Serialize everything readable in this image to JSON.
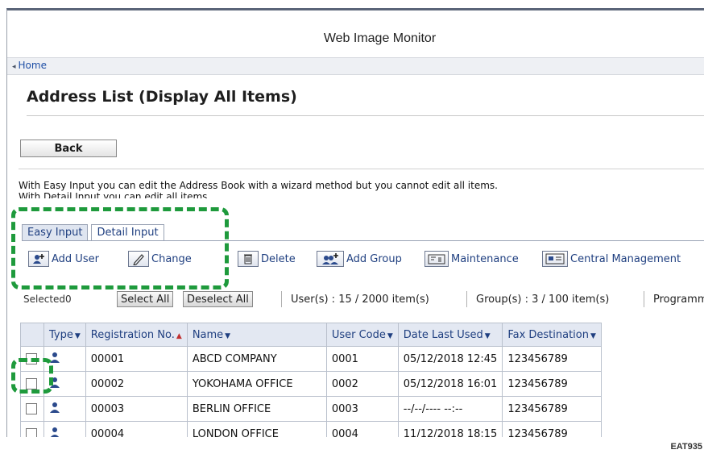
{
  "window": {
    "title": "Web Image Monitor"
  },
  "nav": {
    "home": "Home"
  },
  "page": {
    "title": "Address List (Display All Items)"
  },
  "buttons": {
    "back": "Back"
  },
  "description": {
    "line1": "With Easy Input you can edit the Address Book with a wizard method but you cannot edit all items.",
    "line2": "With Detail Input you can edit all items."
  },
  "tabs": [
    {
      "label": "Easy Input",
      "active": false
    },
    {
      "label": "Detail Input",
      "active": true
    }
  ],
  "toolbar": {
    "add_user": "Add User",
    "change": "Change",
    "delete": "Delete",
    "add_group": "Add Group",
    "maintenance": "Maintenance",
    "central_management": "Central Management"
  },
  "selection": {
    "label": "Selected0",
    "select_all": "Select All",
    "deselect_all": "Deselect All",
    "users": "User(s) : 15 / 2000 item(s)",
    "groups": "Group(s) : 3 / 100 item(s)",
    "program": "Programm"
  },
  "table": {
    "headers": {
      "type": "Type",
      "reg_no": "Registration No.",
      "name": "Name",
      "user_code": "User Code",
      "date_last_used": "Date Last Used",
      "fax_destination": "Fax Destination"
    },
    "rows": [
      {
        "reg_no": "00001",
        "name": "ABCD COMPANY",
        "user_code": "0001",
        "date": "05/12/2018 12:45",
        "fax": "123456789"
      },
      {
        "reg_no": "00002",
        "name": "YOKOHAMA OFFICE",
        "user_code": "0002",
        "date": "05/12/2018 16:01",
        "fax": "123456789"
      },
      {
        "reg_no": "00003",
        "name": "BERLIN OFFICE",
        "user_code": "0003",
        "date": "--/--/---- --:--",
        "fax": "123456789"
      },
      {
        "reg_no": "00004",
        "name": "LONDON OFFICE",
        "user_code": "0004",
        "date": "11/12/2018 18:15",
        "fax": "123456789"
      }
    ]
  },
  "figure_id": "EAT935",
  "colors": {
    "callout": "#1e9a3c",
    "link": "#1f3f80",
    "header_bg": "#e3e8f2"
  },
  "icons": [
    "add-user-icon",
    "change-pencil-icon",
    "delete-icon",
    "add-group-icon",
    "maintenance-icon",
    "central-management-icon",
    "user-type-icon"
  ]
}
